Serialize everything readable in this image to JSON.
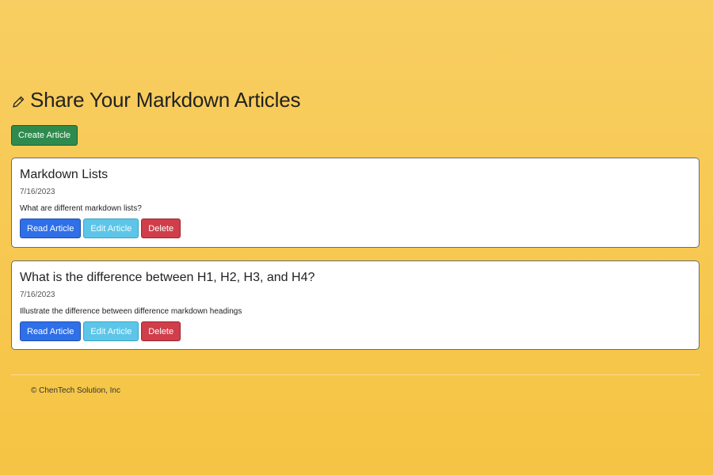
{
  "header": {
    "title": "Share Your Markdown Articles",
    "icon": "pencil-icon"
  },
  "actions": {
    "create_label": "Create Article"
  },
  "articles": [
    {
      "title": "Markdown Lists",
      "date": "7/16/2023",
      "description": "What are different markdown lists?",
      "read_label": "Read Article",
      "edit_label": "Edit Article",
      "delete_label": "Delete"
    },
    {
      "title": "What is the difference between H1, H2, H3, and H4?",
      "date": "7/16/2023",
      "description": "Illustrate the difference between difference markdown headings",
      "read_label": "Read Article",
      "edit_label": "Edit Article",
      "delete_label": "Delete"
    }
  ],
  "footer": {
    "text": "© ChenTech Solution, Inc"
  },
  "colors": {
    "background": "#f7c84f",
    "create_button": "#2f8a4e",
    "read_button": "#2f6fe8",
    "edit_button": "#5dc6e8",
    "delete_button": "#cf3e4a"
  }
}
